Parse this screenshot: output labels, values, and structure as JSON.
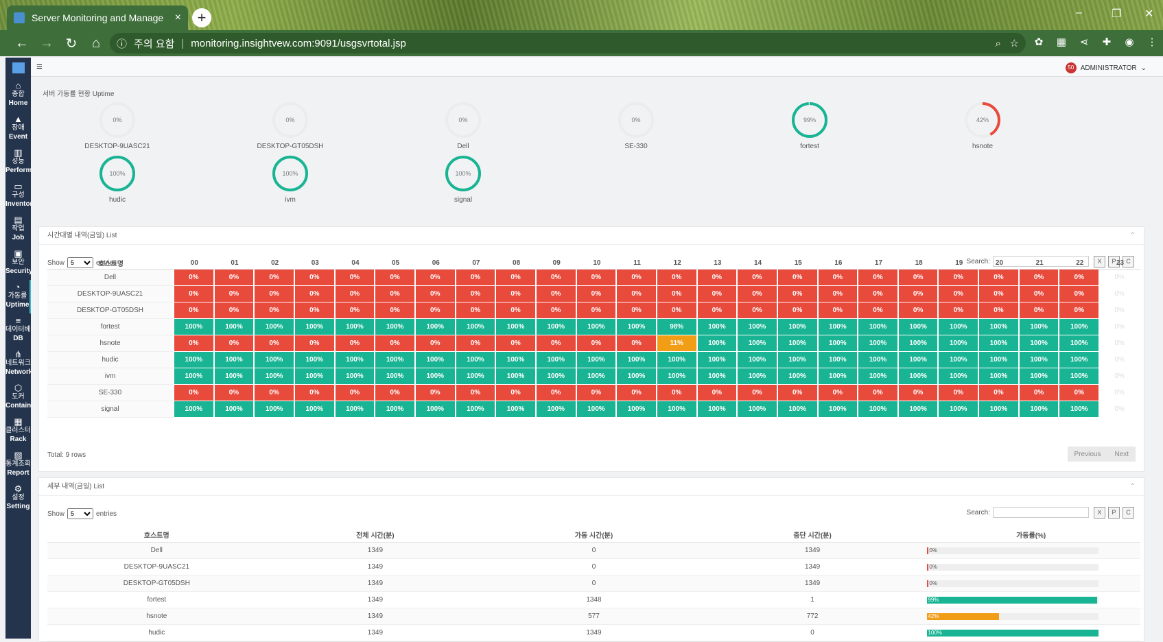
{
  "browser": {
    "tab_title": "Server Monitoring and Manage",
    "tab_close": "×",
    "new_tab": "+",
    "security_text": "주의 요함",
    "url": "monitoring.insightvew.com:9091/usgsvrtotal.jsp"
  },
  "topbar": {
    "user": "ADMINISTRATOR",
    "notif_count": "50"
  },
  "sidebar": [
    {
      "icon": "home-icon",
      "glyph": "⌂",
      "ko": "종합",
      "en": "Home"
    },
    {
      "icon": "warning-icon",
      "glyph": "▲",
      "ko": "장애",
      "en": "Event"
    },
    {
      "icon": "bar-chart-icon",
      "glyph": "▥",
      "ko": "성능",
      "en": "Performance"
    },
    {
      "icon": "monitor-icon",
      "glyph": "▭",
      "ko": "구성",
      "en": "Inventory"
    },
    {
      "icon": "file-icon",
      "glyph": "▤",
      "ko": "작업",
      "en": "Job"
    },
    {
      "icon": "lock-icon",
      "glyph": "▣",
      "ko": "보안",
      "en": "Security"
    },
    {
      "icon": "dashboard-icon",
      "glyph": "◔",
      "ko": "가동률",
      "en": "Uptime"
    },
    {
      "icon": "database-icon",
      "glyph": "≡",
      "ko": "데이터베이스",
      "en": "DB"
    },
    {
      "icon": "network-icon",
      "glyph": "⋔",
      "ko": "네트워크",
      "en": "Network"
    },
    {
      "icon": "container-icon",
      "glyph": "⬡",
      "ko": "도커",
      "en": "Container"
    },
    {
      "icon": "rack-icon",
      "glyph": "▦",
      "ko": "클러스터",
      "en": "Rack"
    },
    {
      "icon": "report-icon",
      "glyph": "▧",
      "ko": "통계조회",
      "en": "Report"
    },
    {
      "icon": "gears-icon",
      "glyph": "⚙",
      "ko": "설정",
      "en": "Setting"
    }
  ],
  "uptime": {
    "title": "서버 가동률 현황 Uptime",
    "servers": [
      {
        "name": "DESKTOP-9UASC21",
        "pct": 0,
        "label": "0%"
      },
      {
        "name": "DESKTOP-GT05DSH",
        "pct": 0,
        "label": "0%"
      },
      {
        "name": "Dell",
        "pct": 0,
        "label": "0%"
      },
      {
        "name": "SE-330",
        "pct": 0,
        "label": "0%"
      },
      {
        "name": "fortest",
        "pct": 99,
        "label": "99%"
      },
      {
        "name": "hsnote",
        "pct": 42,
        "label": "42%"
      },
      {
        "name": "hudic",
        "pct": 100,
        "label": "100%"
      },
      {
        "name": "ivm",
        "pct": 100,
        "label": "100%"
      },
      {
        "name": "signal",
        "pct": 100,
        "label": "100%"
      }
    ]
  },
  "hourly": {
    "title": "시간대별 내역(금일) List",
    "show_label": "Show",
    "entries_label": "entries",
    "page_size": "5",
    "search_label": "Search:",
    "host_header": "호스트명",
    "hours": [
      "00",
      "01",
      "02",
      "03",
      "04",
      "05",
      "06",
      "07",
      "08",
      "09",
      "10",
      "11",
      "12",
      "13",
      "14",
      "15",
      "16",
      "17",
      "18",
      "19",
      "20",
      "21",
      "22",
      "23"
    ],
    "rows": [
      {
        "host": "Dell",
        "values": [
          "0%",
          "0%",
          "0%",
          "0%",
          "0%",
          "0%",
          "0%",
          "0%",
          "0%",
          "0%",
          "0%",
          "0%",
          "0%",
          "0%",
          "0%",
          "0%",
          "0%",
          "0%",
          "0%",
          "0%",
          "0%",
          "0%",
          "0%",
          "0%"
        ]
      },
      {
        "host": "DESKTOP-9UASC21",
        "values": [
          "0%",
          "0%",
          "0%",
          "0%",
          "0%",
          "0%",
          "0%",
          "0%",
          "0%",
          "0%",
          "0%",
          "0%",
          "0%",
          "0%",
          "0%",
          "0%",
          "0%",
          "0%",
          "0%",
          "0%",
          "0%",
          "0%",
          "0%",
          "0%"
        ]
      },
      {
        "host": "DESKTOP-GT05DSH",
        "values": [
          "0%",
          "0%",
          "0%",
          "0%",
          "0%",
          "0%",
          "0%",
          "0%",
          "0%",
          "0%",
          "0%",
          "0%",
          "0%",
          "0%",
          "0%",
          "0%",
          "0%",
          "0%",
          "0%",
          "0%",
          "0%",
          "0%",
          "0%",
          "0%"
        ]
      },
      {
        "host": "fortest",
        "values": [
          "100%",
          "100%",
          "100%",
          "100%",
          "100%",
          "100%",
          "100%",
          "100%",
          "100%",
          "100%",
          "100%",
          "100%",
          "98%",
          "100%",
          "100%",
          "100%",
          "100%",
          "100%",
          "100%",
          "100%",
          "100%",
          "100%",
          "100%",
          "0%"
        ]
      },
      {
        "host": "hsnote",
        "values": [
          "0%",
          "0%",
          "0%",
          "0%",
          "0%",
          "0%",
          "0%",
          "0%",
          "0%",
          "0%",
          "0%",
          "0%",
          "11%",
          "100%",
          "100%",
          "100%",
          "100%",
          "100%",
          "100%",
          "100%",
          "100%",
          "100%",
          "100%",
          "0%"
        ]
      },
      {
        "host": "hudic",
        "values": [
          "100%",
          "100%",
          "100%",
          "100%",
          "100%",
          "100%",
          "100%",
          "100%",
          "100%",
          "100%",
          "100%",
          "100%",
          "100%",
          "100%",
          "100%",
          "100%",
          "100%",
          "100%",
          "100%",
          "100%",
          "100%",
          "100%",
          "100%",
          "0%"
        ]
      },
      {
        "host": "ivm",
        "values": [
          "100%",
          "100%",
          "100%",
          "100%",
          "100%",
          "100%",
          "100%",
          "100%",
          "100%",
          "100%",
          "100%",
          "100%",
          "100%",
          "100%",
          "100%",
          "100%",
          "100%",
          "100%",
          "100%",
          "100%",
          "100%",
          "100%",
          "100%",
          "0%"
        ]
      },
      {
        "host": "SE-330",
        "values": [
          "0%",
          "0%",
          "0%",
          "0%",
          "0%",
          "0%",
          "0%",
          "0%",
          "0%",
          "0%",
          "0%",
          "0%",
          "0%",
          "0%",
          "0%",
          "0%",
          "0%",
          "0%",
          "0%",
          "0%",
          "0%",
          "0%",
          "0%",
          "0%"
        ]
      },
      {
        "host": "signal",
        "values": [
          "100%",
          "100%",
          "100%",
          "100%",
          "100%",
          "100%",
          "100%",
          "100%",
          "100%",
          "100%",
          "100%",
          "100%",
          "100%",
          "100%",
          "100%",
          "100%",
          "100%",
          "100%",
          "100%",
          "100%",
          "100%",
          "100%",
          "100%",
          "0%"
        ]
      }
    ],
    "total": "Total: 9 rows",
    "prev": "Previous",
    "next": "Next"
  },
  "detail": {
    "title": "세부 내역(금일) List",
    "show_label": "Show",
    "entries_label": "entries",
    "page_size": "5",
    "search_label": "Search:",
    "headers": [
      "호스트명",
      "전체 시간(분)",
      "가동 시간(분)",
      "중단 시간(분)",
      "가동률(%)"
    ],
    "rows": [
      {
        "host": "Dell",
        "total": "1349",
        "up": "0",
        "down": "1349",
        "pct": 0,
        "pct_label": "0%"
      },
      {
        "host": "DESKTOP-9UASC21",
        "total": "1349",
        "up": "0",
        "down": "1349",
        "pct": 0,
        "pct_label": "0%"
      },
      {
        "host": "DESKTOP-GT05DSH",
        "total": "1349",
        "up": "0",
        "down": "1349",
        "pct": 0,
        "pct_label": "0%"
      },
      {
        "host": "fortest",
        "total": "1349",
        "up": "1348",
        "down": "1",
        "pct": 99,
        "pct_label": "99%"
      },
      {
        "host": "hsnote",
        "total": "1349",
        "up": "577",
        "down": "772",
        "pct": 42,
        "pct_label": "42%"
      },
      {
        "host": "hudic",
        "total": "1349",
        "up": "1349",
        "down": "0",
        "pct": 100,
        "pct_label": "100%"
      }
    ]
  },
  "colors": {
    "red": "#e84a3c",
    "green": "#18b493",
    "orange": "#f29d16",
    "navy": "#24344d"
  }
}
